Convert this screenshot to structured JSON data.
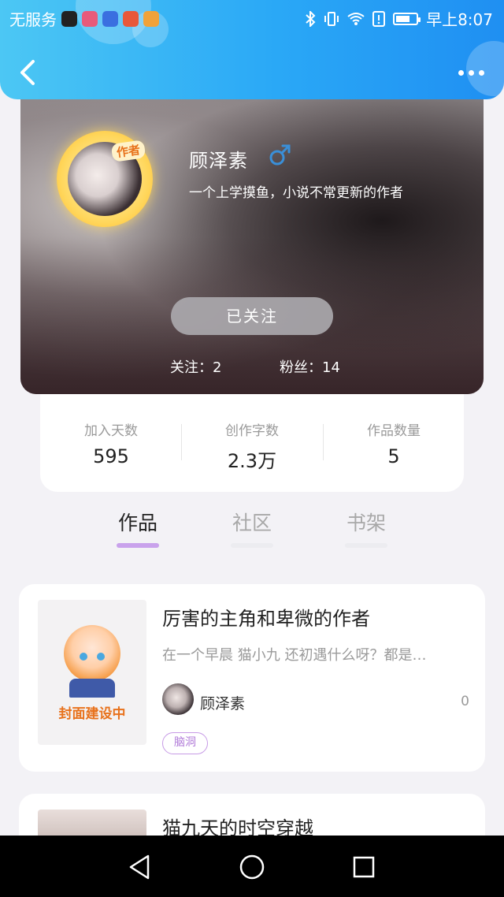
{
  "status_bar": {
    "carrier": "无服务",
    "time": "早上8:07",
    "battery_level": 0.7
  },
  "nav": {
    "back_icon": "chevron-left-icon",
    "more_icon": "more-dots-icon"
  },
  "profile": {
    "name": "顾泽素",
    "badge": "作者",
    "gender_icon": "male-icon",
    "bio": "一个上学摸鱼，小说不常更新的作者",
    "follow_label": "已关注",
    "following_text": "关注：2",
    "followers_text": "粉丝：14"
  },
  "stats": [
    {
      "label": "加入天数",
      "value": "595"
    },
    {
      "label": "创作字数",
      "value": "2.3万"
    },
    {
      "label": "作品数量",
      "value": "5"
    }
  ],
  "tabs": [
    {
      "label": "作品",
      "active": true
    },
    {
      "label": "社区",
      "active": false
    },
    {
      "label": "书架",
      "active": false
    }
  ],
  "colors": {
    "accent": "#c9a2ec",
    "tab_active_underline": "#c9a2ec",
    "tab_inactive_underline": "#ececf0",
    "header_blue": "#2aa8f6"
  },
  "books": [
    {
      "title": "厉害的主角和卑微的作者",
      "description": "在一个早晨 猫小九 还初遇什么呀？都是…",
      "cover_text": "封面建设中",
      "author": "顾泽素",
      "count": "0",
      "tag": "脑洞"
    },
    {
      "title": "猫九天的时空穿越"
    }
  ]
}
